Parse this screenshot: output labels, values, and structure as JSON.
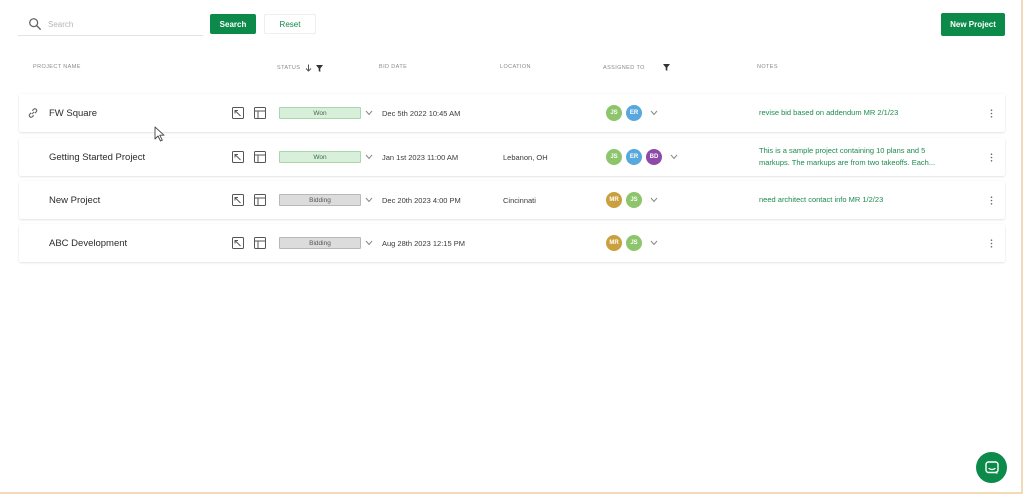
{
  "toolbar": {
    "search_placeholder": "Search",
    "search_value": "",
    "search_label": "Search",
    "reset_label": "Reset",
    "new_project_label": "New Project"
  },
  "headers": {
    "project_name": "PROJECT NAME",
    "status": "STATUS",
    "bid_date": "BID DATE",
    "location": "LOCATION",
    "assigned_to": "ASSIGNED TO",
    "notes": "NOTES"
  },
  "colors": {
    "accent": "#0c8a4a",
    "won_bg": "#d8f0da",
    "bidding_bg": "#dcdcdc",
    "avatar_js": "#8cc56b",
    "avatar_er": "#58a7dd",
    "avatar_bd": "#8e4aa8",
    "avatar_mr": "#c9a03d"
  },
  "projects": [
    {
      "name": "FW Square",
      "status": "Won",
      "bid_date": "Dec 5th 2022 10:45 AM",
      "location": "",
      "assigned": [
        "JS",
        "ER"
      ],
      "notes_line1": "revise bid based on addendum MR 2/1/23",
      "notes_line2": ""
    },
    {
      "name": "Getting Started Project",
      "status": "Won",
      "bid_date": "Jan 1st 2023 11:00 AM",
      "location": "Lebanon, OH",
      "assigned": [
        "JS",
        "ER",
        "BD"
      ],
      "notes_line1": "This is a sample project containing 10 plans and 5",
      "notes_line2": "markups. The markups are from two takeoffs. Each..."
    },
    {
      "name": "New Project",
      "status": "Bidding",
      "bid_date": "Dec 20th 2023 4:00 PM",
      "location": "Cincinnati",
      "assigned": [
        "MR",
        "JS"
      ],
      "notes_line1": "need architect contact info MR 1/2/23",
      "notes_line2": ""
    },
    {
      "name": "ABC Development",
      "status": "Bidding",
      "bid_date": "Aug 28th 2023 12:15 PM",
      "location": "",
      "assigned": [
        "MR",
        "JS"
      ],
      "notes_line1": "",
      "notes_line2": ""
    }
  ]
}
